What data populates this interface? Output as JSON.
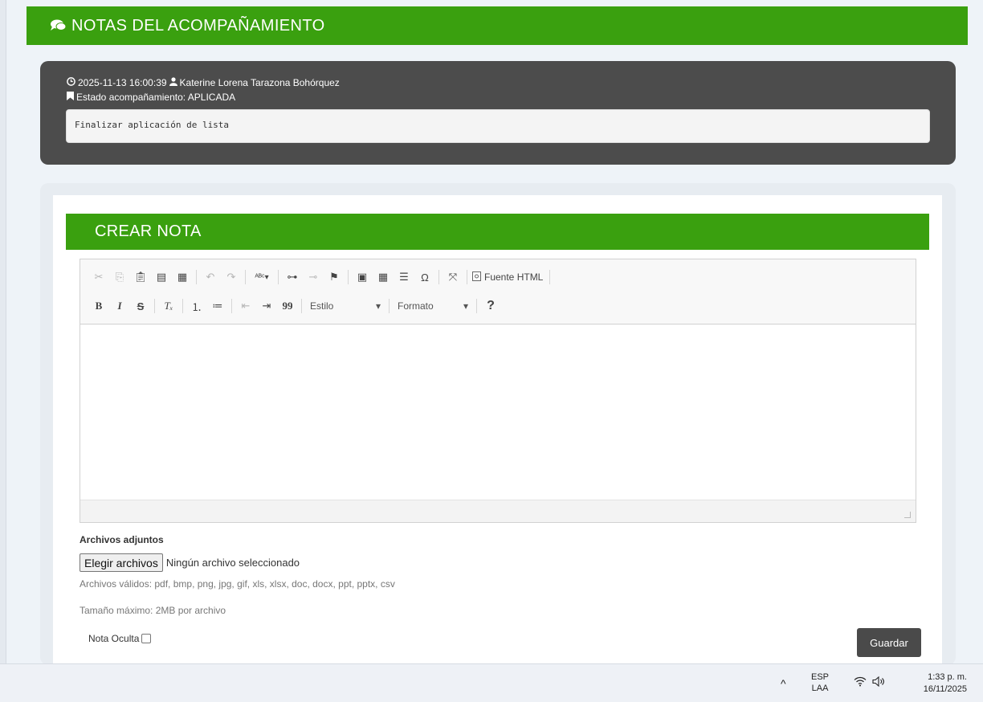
{
  "header": {
    "title": "NOTAS DEL ACOMPAÑAMIENTO",
    "icon": "comments-icon"
  },
  "note": {
    "timestamp": "2025-11-13 16:00:39",
    "author": "Katerine Lorena Tarazona Bohórquez",
    "status": "Estado acompañamiento: APLICADA",
    "body": "Finalizar aplicación de lista"
  },
  "create": {
    "title": "CREAR NOTA",
    "toolbar": {
      "source_label": "Fuente HTML",
      "style_label": "Estilo",
      "format_label": "Formato",
      "help_label": "?",
      "bold": "B",
      "italic": "I",
      "strike": "S",
      "quote": "99",
      "special_char": "Ω"
    },
    "attachments_label": "Archivos adjuntos",
    "choose_button": "Elegir archivos",
    "no_file": "Ningún archivo seleccionado",
    "valid_files": "Archivos válidos: pdf, bmp, png, jpg, gif, xls, xlsx, doc, docx, ppt, pptx, csv",
    "max_size": "Tamaño máximo: 2MB por archivo",
    "hidden_note_label": "Nota Oculta",
    "save_button": "Guardar"
  },
  "taskbar": {
    "chevron": "^",
    "lang_top": "ESP",
    "lang_bottom": "LAA",
    "time": "1:33 p. m.",
    "date": "16/11/2025"
  },
  "colors": {
    "green": "#3aa00f",
    "dark_card": "#4c4c4c",
    "save_button": "#4a4a4a"
  }
}
